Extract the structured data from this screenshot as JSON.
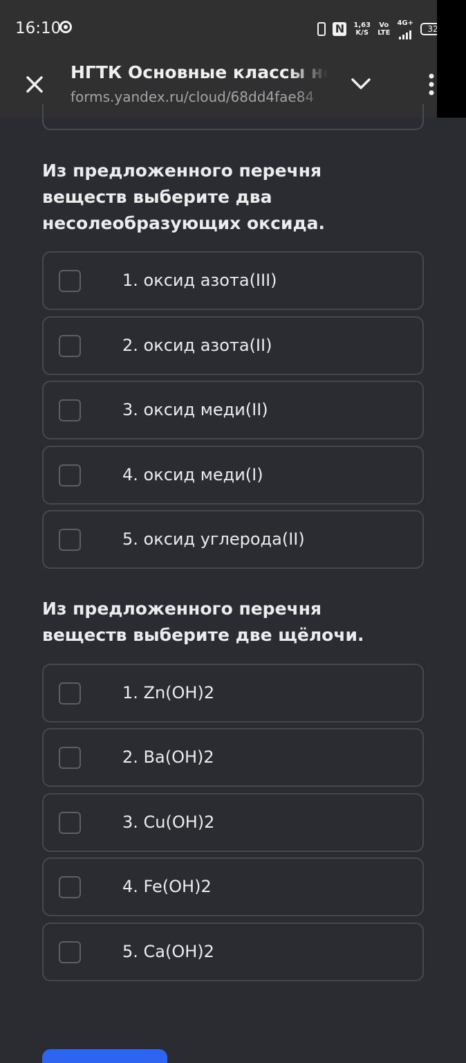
{
  "status_bar": {
    "time": "16:10",
    "speed_value": "1,63",
    "speed_unit": "K/S",
    "volte_top": "Vo",
    "volte_bottom": "LTE",
    "network": "4G+",
    "battery": "32",
    "nfc_label": "N",
    "icons": [
      "sync-ring-icon",
      "vibrate-icon",
      "nfc-icon",
      "signal-icon",
      "battery-icon"
    ]
  },
  "browser": {
    "title": "НГТК Основные классы неорганических веществ",
    "url": "forms.yandex.ru/cloud/68dd4fae84",
    "icons": [
      "close-icon",
      "chevron-down-icon",
      "more-vertical-icon"
    ]
  },
  "questions": [
    {
      "title": "Из предложенного перечня веществ выберите два несолеобразующих оксида.",
      "options": [
        {
          "label": "1. оксид азота(III)",
          "checked": false
        },
        {
          "label": "2. оксид азота(II)",
          "checked": false
        },
        {
          "label": "3. оксид меди(II)",
          "checked": false
        },
        {
          "label": "4. оксид меди(I)",
          "checked": false
        },
        {
          "label": "5. оксид углерода(II)",
          "checked": false
        }
      ]
    },
    {
      "title": "Из предложенного перечня веществ выберите две щёлочи.",
      "options": [
        {
          "label": "1. Zn(OH)2",
          "checked": false
        },
        {
          "label": "2. Ba(OH)2",
          "checked": false
        },
        {
          "label": "3. Cu(OH)2",
          "checked": false
        },
        {
          "label": "4. Fe(OH)2",
          "checked": false
        },
        {
          "label": "5. Ca(OH)2",
          "checked": false
        }
      ]
    }
  ],
  "colors": {
    "background": "#2b2b32",
    "card_border": "#47474f",
    "toolbar": "#303030",
    "accent": "#2d64f0"
  }
}
